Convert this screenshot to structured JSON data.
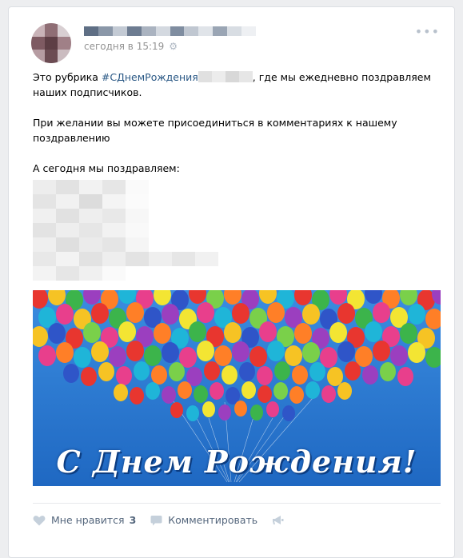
{
  "post": {
    "timestamp": "сегодня в 15:19",
    "text": {
      "line1_before": "Это рубрика ",
      "hashtag": "#СДнемРождения",
      "line1_after": ", где мы ежедневно поздравляем наших подписчиков.",
      "paragraph2": "При желании вы можете присоединиться в комментариях к нашему поздравлению",
      "paragraph3": "А сегодня мы поздравляем:"
    },
    "image": {
      "caption": "С Днем Рождения!"
    }
  },
  "actions": {
    "like_label": "Мне нравится",
    "like_count": "3",
    "comment_label": "Комментировать"
  },
  "icons": {
    "settings": "gear-icon",
    "more": "more-options-icon",
    "like": "heart-icon",
    "comment": "comment-icon",
    "share": "megaphone-icon"
  },
  "colors": {
    "link": "#2a5885",
    "meta": "#939393",
    "action": "#55677d",
    "page_bg": "#edeef0"
  }
}
